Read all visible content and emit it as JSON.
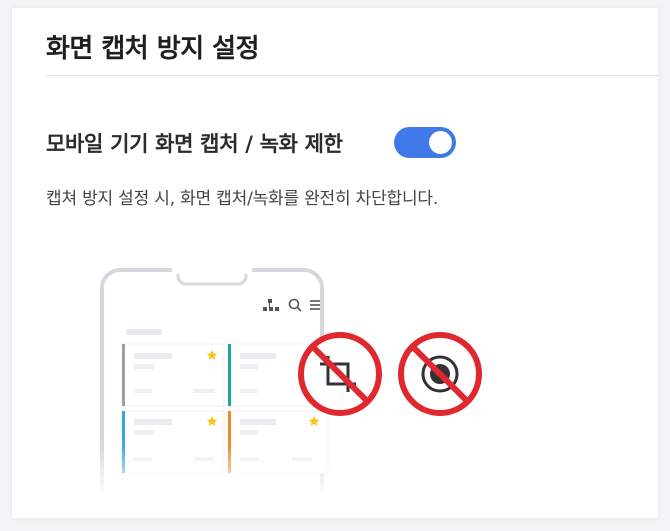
{
  "page": {
    "title": "화면 캡처 방지 설정"
  },
  "setting": {
    "label": "모바일 기기 화면 캡처 / 녹화 제한",
    "enabled": true,
    "description": "캡쳐 방지 설정 시, 화면 캡처/녹화를 완전히 차단합니다."
  },
  "illustration": {
    "phone_icons": [
      "sitemap-icon",
      "search-icon",
      "menu-icon"
    ],
    "prohibited_icons": [
      "crop-icon",
      "record-icon"
    ],
    "colors": {
      "toggle_on": "#3f7ae8",
      "prohibit_red": "#e0292f",
      "card_gray": "#9aa0a6",
      "card_teal": "#1aa89a",
      "card_blue": "#3aa6e8",
      "card_orange": "#ef8a2f",
      "star": "#f5c518"
    }
  }
}
